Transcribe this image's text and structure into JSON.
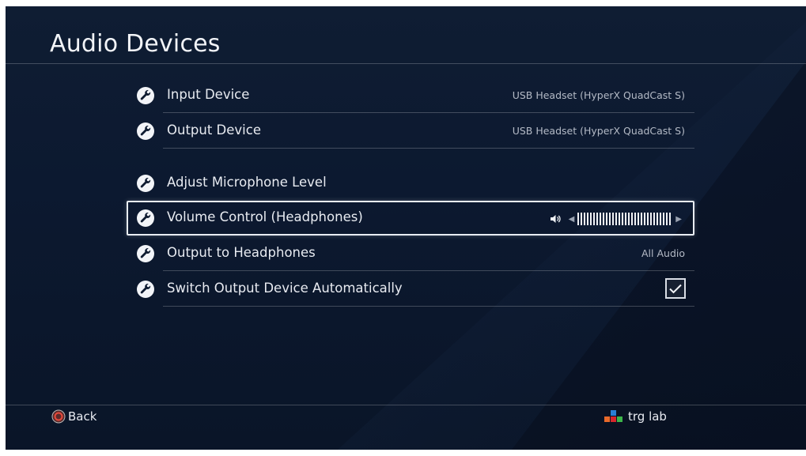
{
  "page": {
    "title": "Audio Devices"
  },
  "settings": {
    "items": [
      {
        "label": "Input Device",
        "value": "USB Headset (HyperX QuadCast S)"
      },
      {
        "label": "Output Device",
        "value": "USB Headset (HyperX QuadCast S)"
      },
      {
        "label": "Adjust Microphone Level"
      },
      {
        "label": "Volume Control (Headphones)",
        "volume_level": 1.0
      },
      {
        "label": "Output to Headphones",
        "value": "All Audio"
      },
      {
        "label": "Switch Output Device Automatically",
        "checked": true
      }
    ],
    "selected_index": 3
  },
  "footer": {
    "back_label": "Back",
    "brand_label": "trg lab"
  },
  "colors": {
    "background": "#0c1930",
    "back_button": "#d9382b",
    "logo_orange": "#e8692a",
    "logo_red": "#d6262b",
    "logo_blue": "#2a7fd4",
    "logo_green": "#3db54a"
  },
  "icons": {
    "setting": "wrench-icon",
    "volume": "speaker-icon",
    "checkbox": "checkmark-icon",
    "back": "circle-button-icon"
  }
}
